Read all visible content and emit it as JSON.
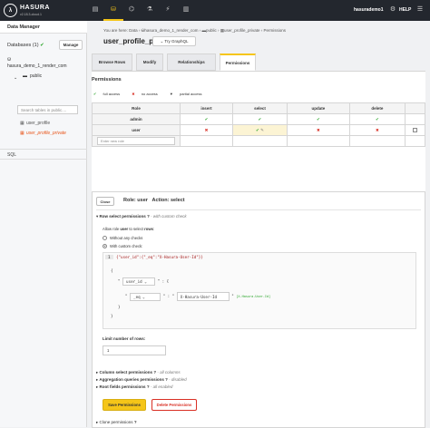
{
  "topbar": {
    "logo_text": "HASURA",
    "version": "v2.18.3-cloud.1",
    "user": "hasurademo1",
    "help": "HELP",
    "nav_icons": [
      "terminal-icon",
      "database-icon",
      "graphql-icon",
      "flask-icon",
      "events-icon",
      "chart-icon"
    ],
    "accent": "#f5c518",
    "bg": "#23272e"
  },
  "sidebar": {
    "title": "Data Manager",
    "databases_label": "Databases (1)",
    "manage_label": "Manage",
    "db_name": "hasura_demo_1_render_com",
    "schema": "public",
    "search_placeholder": "Search tables in public....",
    "tables": [
      "user_profile",
      "user_profile_private"
    ],
    "sql_label": "SQL"
  },
  "main": {
    "breadcrumb": [
      "You are here:",
      "Data",
      "hasura_demo_1_render_com",
      "public",
      "user_profile_private",
      "Permissions"
    ],
    "title": "user_profile_private",
    "try_graphql": "Try GraphQL",
    "tabs": [
      "Browse Rows",
      "Modify",
      "Relationships",
      "Permissions"
    ],
    "permissions_heading": "Permissions",
    "legend": {
      "full": "full access",
      "none": "no access",
      "partial": "partial access"
    },
    "table": {
      "headers": [
        "Role",
        "insert",
        "select",
        "update",
        "delete"
      ],
      "rows": [
        {
          "role": "admin",
          "cells": [
            "✔",
            "✔",
            "✔",
            "✔"
          ]
        },
        {
          "role": "user",
          "cells": [
            "✖",
            "✔",
            "✖",
            "✖"
          ]
        }
      ],
      "new_role_placeholder": "Enter new role"
    }
  },
  "panel": {
    "close_label": "Close",
    "role_label": "Role:",
    "role_value": "user",
    "action_label": "Action:",
    "action_value": "select",
    "row_select_title": "Row select permissions",
    "row_select_note": "- with custom check",
    "allow_text_1": "Allow role",
    "allow_role": "user",
    "allow_text_2": "to select",
    "allow_rows": "rows",
    "opt_without": "Without any checks",
    "opt_with": "With custom check:",
    "json_line": "{\"user_id\":{\"_eq\":\"X-Hasura-User-Id\"}}",
    "line_no": "1",
    "field": "user_id",
    "op": "_eq",
    "value": "X-Hasura-User-Id",
    "value_hint": "[X-Hasura-User-Id]",
    "limit_label": "Limit number of rows:",
    "limit_value": "1",
    "col_select_title": "Column select permissions",
    "col_select_note": "- all columns",
    "agg_title": "Aggregation queries permissions",
    "agg_note": "- disabled",
    "root_title": "Root fields permissions",
    "root_note": "- all enabled",
    "save_label": "Save Permissions",
    "delete_label": "Delete Permissions",
    "clone_label": "Clone permissions"
  }
}
